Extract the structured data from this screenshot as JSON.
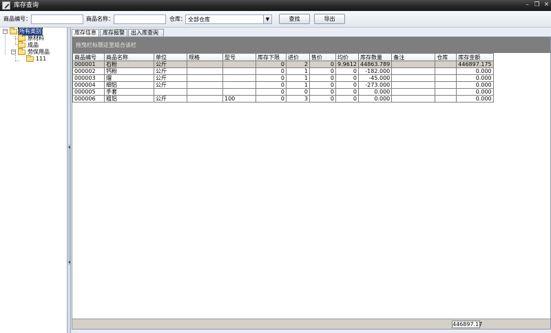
{
  "window": {
    "title": "库存查询"
  },
  "toolbar": {
    "product_code_label": "商品编号：",
    "product_code_value": "",
    "product_name_label": "商品名称：",
    "product_name_value": "",
    "warehouse_label": "仓库：",
    "warehouse_value": "全部仓库",
    "search_label": "查找",
    "export_label": "导出"
  },
  "tree": {
    "root": "所有类别",
    "items": [
      {
        "label": "原材料"
      },
      {
        "label": "成品"
      },
      {
        "label": "劳保用品"
      },
      {
        "label": "111"
      }
    ]
  },
  "tabs": [
    {
      "label": "库存信息"
    },
    {
      "label": "库存报警"
    },
    {
      "label": "出入库查询"
    }
  ],
  "grid": {
    "group_hint": "拖曳栏标题这里组合该栏",
    "columns": [
      "商品编号",
      "商品名称",
      "单位",
      "规格",
      "型号",
      "库存下限",
      "进价",
      "售价",
      "均价",
      "库存数量",
      "备注",
      "仓库",
      "库存金额"
    ],
    "rows": [
      [
        "000001",
        "石粉",
        "公斤",
        "",
        "",
        "0",
        "2",
        "0",
        "9.9612",
        "44863.789",
        "",
        "",
        "446897.175"
      ],
      [
        "000002",
        "钙粉",
        "公斤",
        "",
        "",
        "0",
        "1",
        "0",
        "0",
        "-182.000",
        "",
        "",
        "0.000"
      ],
      [
        "000003",
        "熘",
        "公斤",
        "",
        "",
        "0",
        "1",
        "0",
        "0",
        "-45.000",
        "",
        "",
        "0.000"
      ],
      [
        "000004",
        "细铝",
        "公斤",
        "",
        "",
        "0",
        "1",
        "0",
        "0",
        "-273.000",
        "",
        "",
        "0.000"
      ],
      [
        "000005",
        "手套",
        "",
        "",
        "",
        "0",
        "0",
        "0",
        "0",
        "0.000",
        "",
        "",
        "0.000"
      ],
      [
        "000006",
        "粗铝",
        "公斤",
        "",
        "100",
        "0",
        "3",
        "0",
        "0",
        "0.000",
        "",
        "",
        "0.000"
      ]
    ],
    "footer_total": "446897.17"
  }
}
